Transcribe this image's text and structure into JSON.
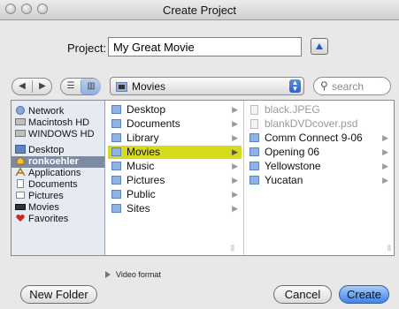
{
  "window": {
    "title": "Create Project"
  },
  "project": {
    "label": "Project:",
    "value": "My Great Movie"
  },
  "location_popup": {
    "value": "Movies"
  },
  "search": {
    "placeholder": "search"
  },
  "sidebar": {
    "items": [
      {
        "label": "Network",
        "icon": "globe-icon"
      },
      {
        "label": "Macintosh HD",
        "icon": "hard-drive-icon"
      },
      {
        "label": "WINDOWS HD",
        "icon": "hard-drive-icon"
      },
      {
        "label": "Desktop",
        "icon": "desktop-icon"
      },
      {
        "label": "ronkoehler",
        "icon": "home-icon",
        "selected": true
      },
      {
        "label": "Applications",
        "icon": "applications-icon"
      },
      {
        "label": "Documents",
        "icon": "documents-icon"
      },
      {
        "label": "Pictures",
        "icon": "pictures-icon"
      },
      {
        "label": "Movies",
        "icon": "movies-icon"
      },
      {
        "label": "Favorites",
        "icon": "heart-icon"
      }
    ]
  },
  "column1": {
    "items": [
      {
        "label": "Desktop"
      },
      {
        "label": "Documents"
      },
      {
        "label": "Library"
      },
      {
        "label": "Movies",
        "selected": true
      },
      {
        "label": "Music"
      },
      {
        "label": "Pictures"
      },
      {
        "label": "Public"
      },
      {
        "label": "Sites"
      }
    ]
  },
  "column2": {
    "items": [
      {
        "label": "black.JPEG",
        "disabled": true
      },
      {
        "label": "blankDVDcover.psd",
        "disabled": true
      },
      {
        "label": "Comm Connect 9-06"
      },
      {
        "label": "Opening 06"
      },
      {
        "label": "Yellowstone"
      },
      {
        "label": "Yucatan"
      }
    ]
  },
  "format_toggle": {
    "label": "Video format"
  },
  "buttons": {
    "new_folder": "New Folder",
    "cancel": "Cancel",
    "create": "Create"
  },
  "colors": {
    "selection": "#d6dc1c",
    "sidebar_selection": "#7c8aa3",
    "default_button": "#3f84e6"
  }
}
